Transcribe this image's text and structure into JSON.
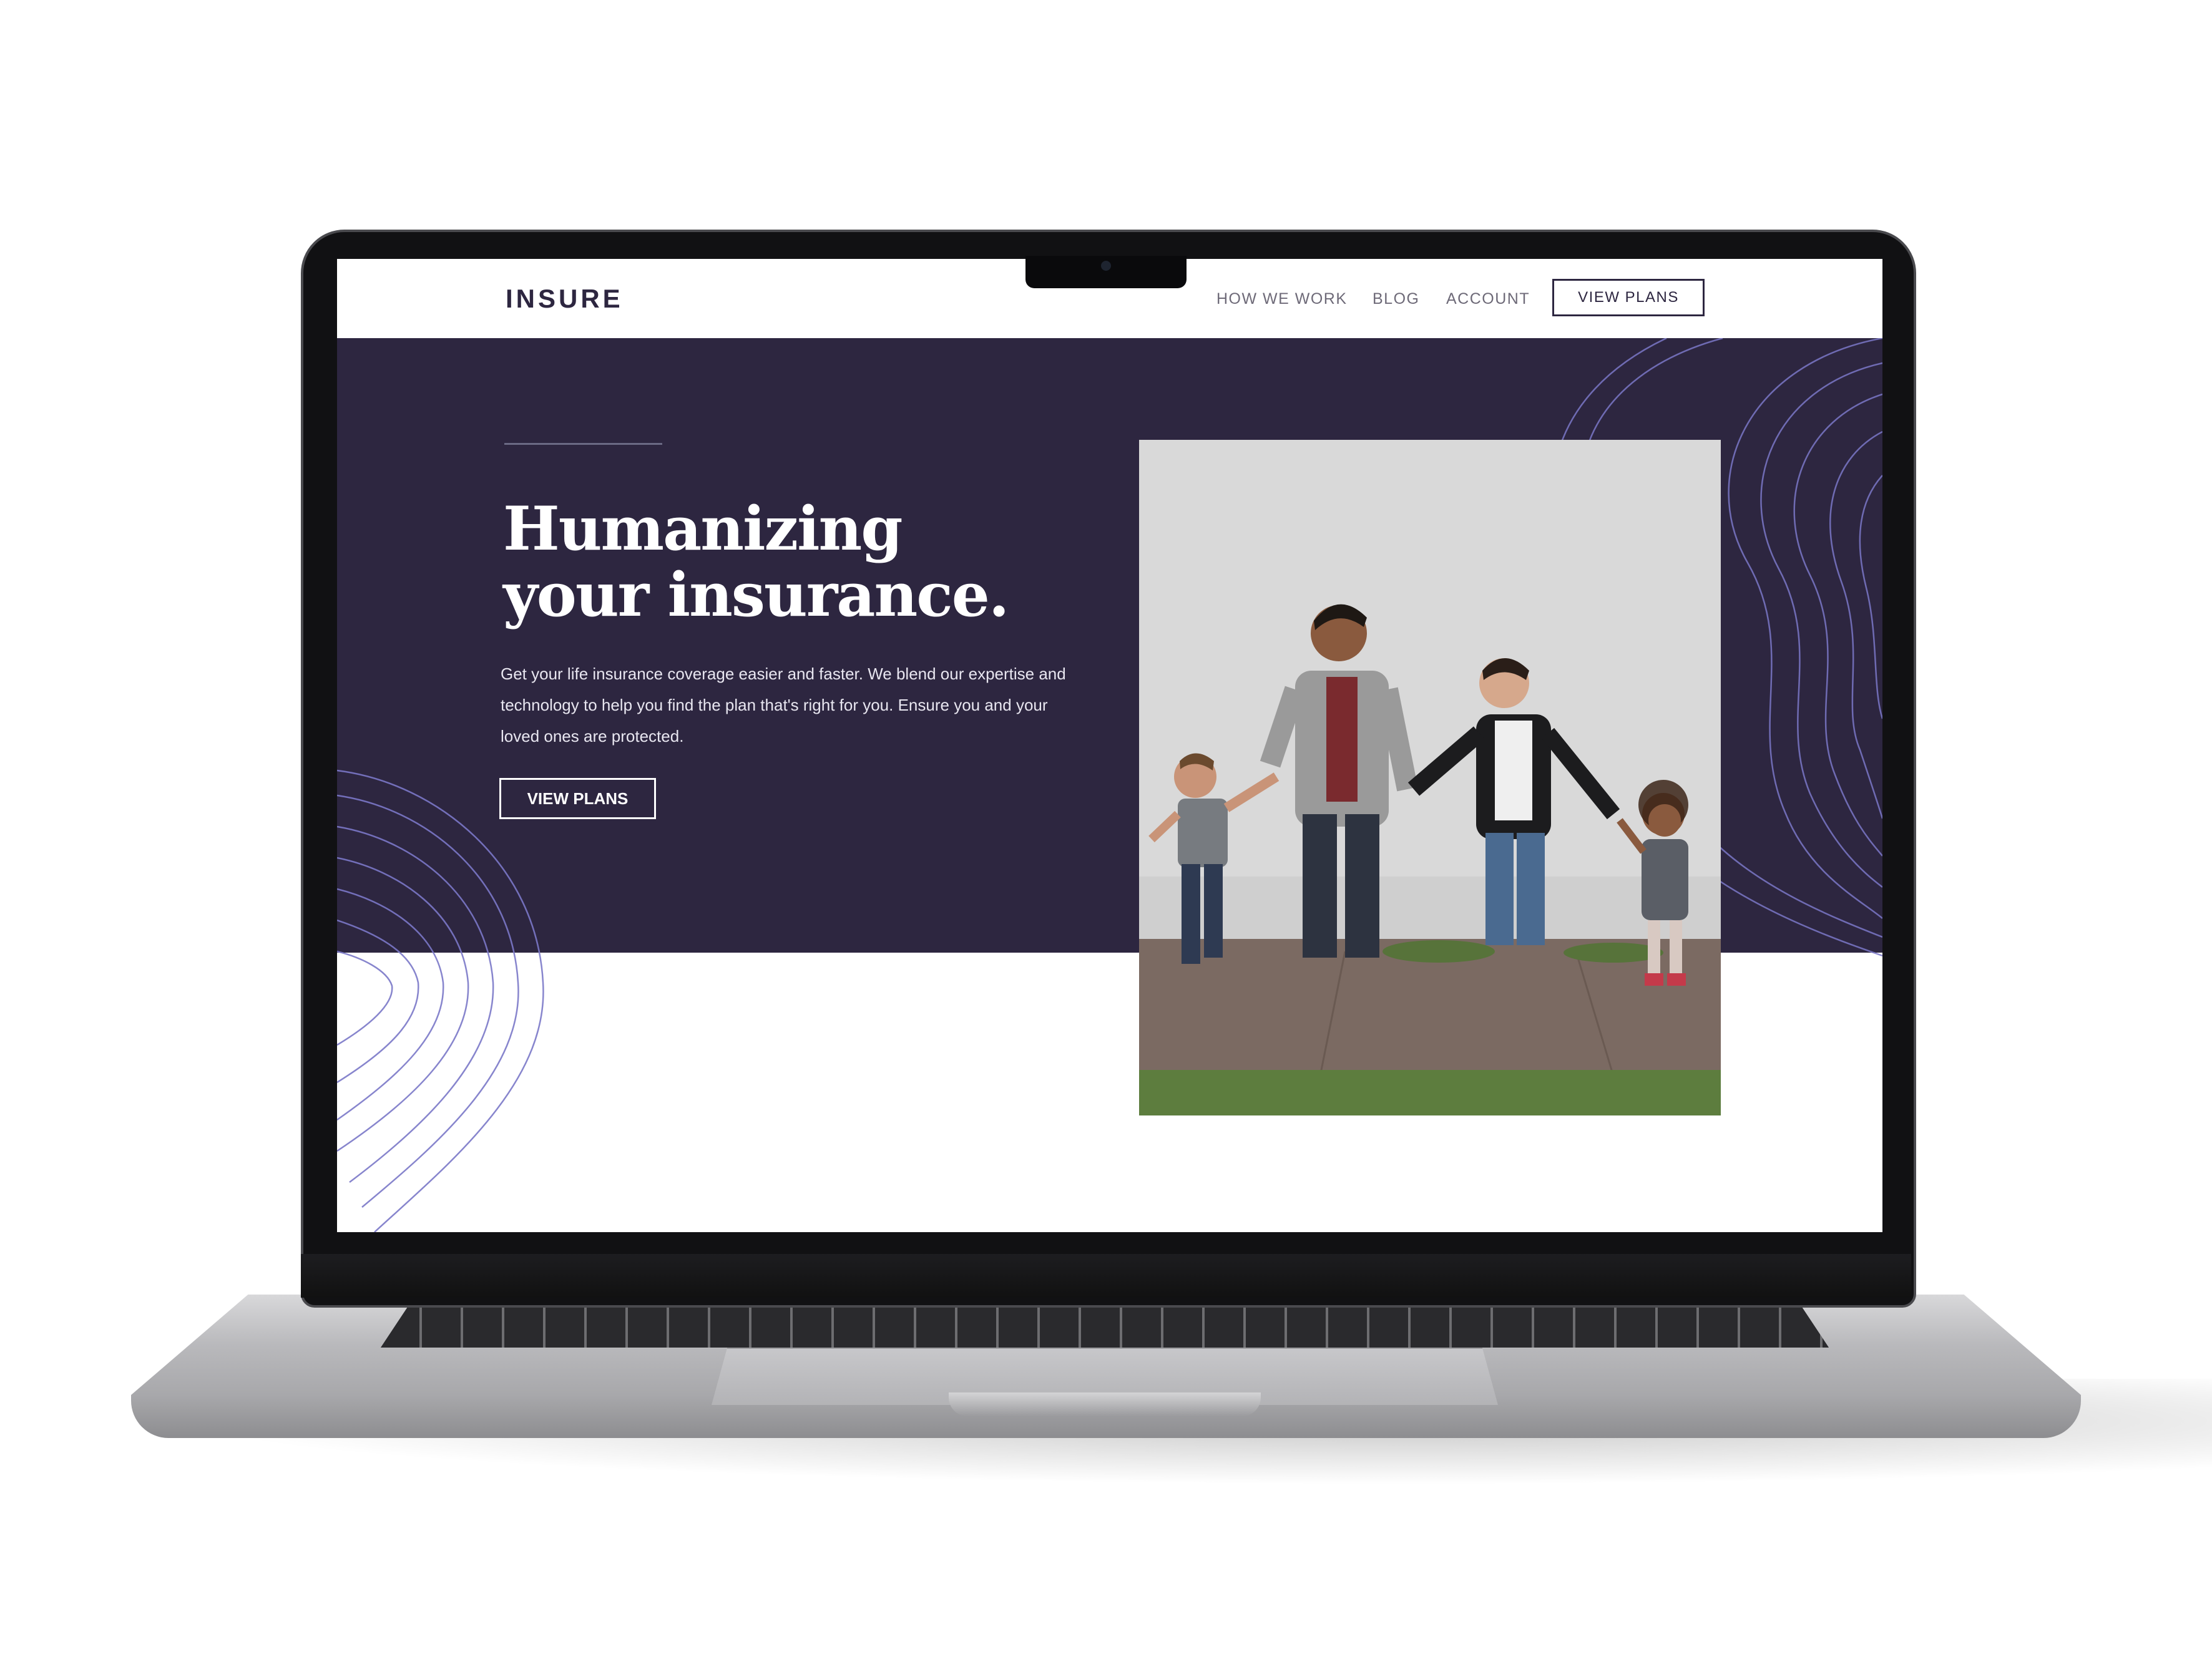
{
  "site": {
    "logo": "INSURE",
    "nav": [
      {
        "label": "HOW WE WORK"
      },
      {
        "label": "BLOG"
      },
      {
        "label": "ACCOUNT"
      }
    ],
    "nav_cta": "VIEW PLANS"
  },
  "hero": {
    "headline_line1": "Humanizing",
    "headline_line2": "your insurance.",
    "subcopy": "Get your life insurance coverage easier and faster. We blend our expertise and technology to help you find the plan that's right for you. Ensure you and your loved ones are protected.",
    "cta": "VIEW PLANS"
  },
  "colors": {
    "brand_navy": "#2d2640",
    "topo_line": "#7b78c8",
    "laptop_silver": "#b9b9bc"
  },
  "icons": {
    "camera": "webcam-icon"
  }
}
